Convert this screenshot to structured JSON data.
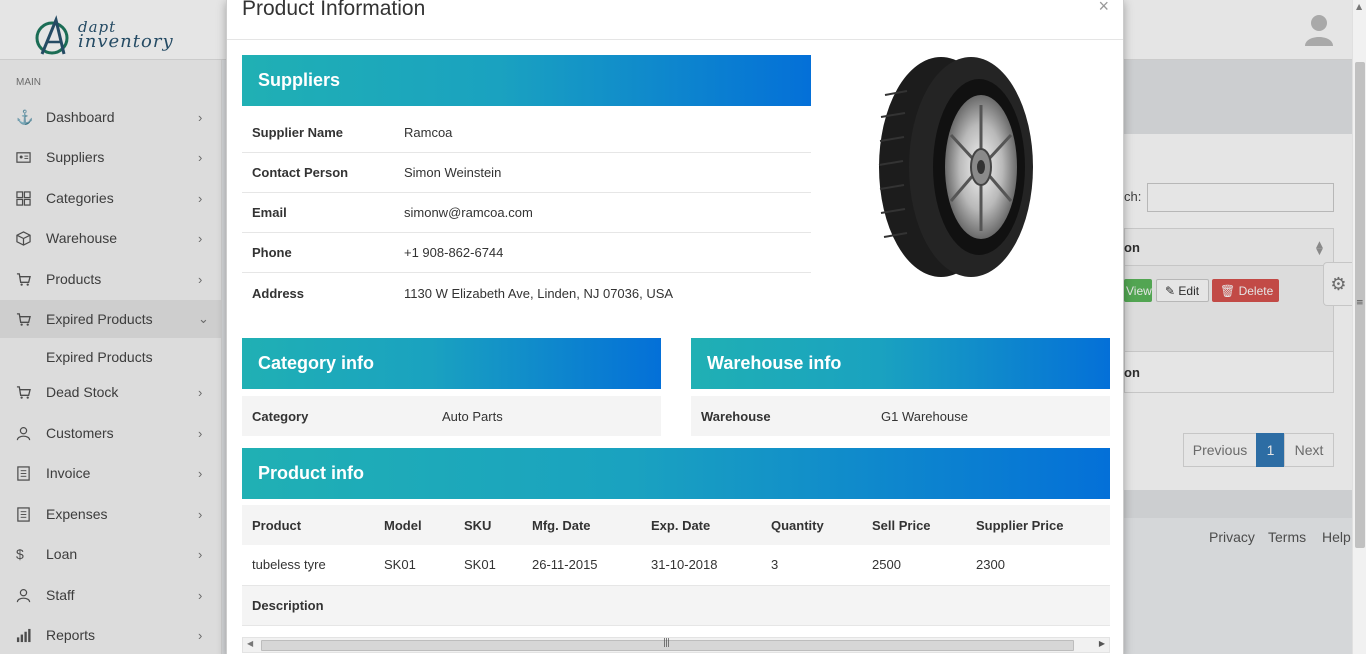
{
  "app": {
    "logo_line1": "dapt",
    "logo_line2": "inventory",
    "sidebar_heading": "MAIN",
    "sidebar": [
      {
        "label": "Dashboard",
        "icon": "anchor-icon"
      },
      {
        "label": "Suppliers",
        "icon": "id-card-icon"
      },
      {
        "label": "Categories",
        "icon": "grid-icon"
      },
      {
        "label": "Warehouse",
        "icon": "cube-icon"
      },
      {
        "label": "Products",
        "icon": "cart-icon"
      },
      {
        "label": "Expired Products",
        "icon": "cart-icon",
        "active": true
      },
      {
        "label": "Dead Stock",
        "icon": "cart-icon"
      },
      {
        "label": "Customers",
        "icon": "user-icon"
      },
      {
        "label": "Invoice",
        "icon": "invoice-icon"
      },
      {
        "label": "Expenses",
        "icon": "invoice-icon"
      },
      {
        "label": "Loan",
        "icon": "dollar-icon"
      },
      {
        "label": "Staff",
        "icon": "user-icon"
      },
      {
        "label": "Reports",
        "icon": "bar-chart-icon"
      }
    ],
    "sidebar_sub": "Expired Products",
    "background": {
      "search_label": "ch:",
      "col_header": "on",
      "view_btn": "View",
      "edit_btn": "Edit",
      "delete_btn": "Delete",
      "foot_header": "on",
      "pager_prev": "Previous",
      "pager_current": "1",
      "pager_next": "Next",
      "footer_privacy": "Privacy",
      "footer_terms": "Terms",
      "footer_help": "Help"
    }
  },
  "modal": {
    "title": "Product Information",
    "close": "×",
    "suppliers": {
      "heading": "Suppliers",
      "rows": [
        {
          "key": "Supplier Name",
          "value": "Ramcoa"
        },
        {
          "key": "Contact Person",
          "value": "Simon Weinstein"
        },
        {
          "key": "Email",
          "value": "simonw@ramcoa.com"
        },
        {
          "key": "Phone",
          "value": "+1 908-862-6744"
        },
        {
          "key": "Address",
          "value": "1130 W Elizabeth Ave, Linden, NJ 07036, USA"
        }
      ]
    },
    "category": {
      "heading": "Category info",
      "key": "Category",
      "value": "Auto Parts"
    },
    "warehouse": {
      "heading": "Warehouse info",
      "key": "Warehouse",
      "value": "G1 Warehouse"
    },
    "product": {
      "heading": "Product info",
      "columns": [
        "Product",
        "Model",
        "SKU",
        "Mfg. Date",
        "Exp. Date",
        "Quantity",
        "Sell Price",
        "Supplier Price"
      ],
      "row": [
        "tubeless tyre",
        "SK01",
        "SK01",
        "26-11-2015",
        "31-10-2018",
        "3",
        "2500",
        "2300"
      ],
      "description_label": "Description"
    },
    "colors": {
      "band_start": "#20b0b4",
      "band_end": "#0470d8"
    }
  }
}
